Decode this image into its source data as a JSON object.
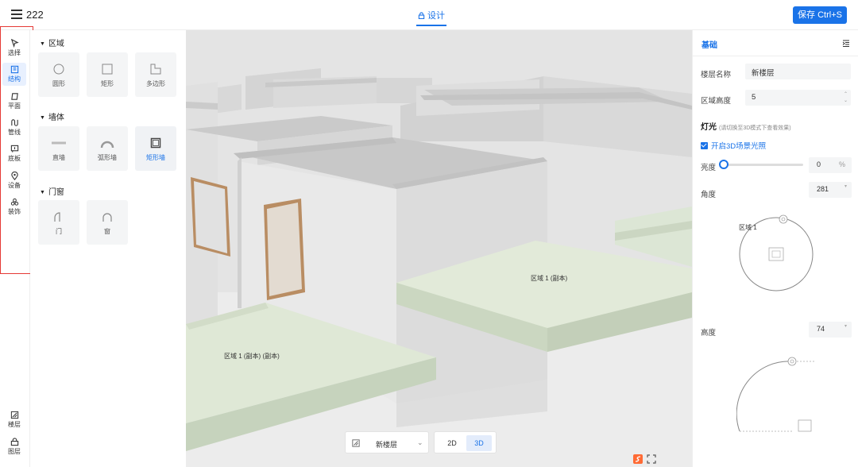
{
  "header": {
    "project_name": "222",
    "design_tab": "设计",
    "save_button": "保存 Ctrl+S"
  },
  "left_toolbar": {
    "tools": [
      {
        "label": "选择",
        "icon": "cursor-icon"
      },
      {
        "label": "结构",
        "icon": "structure-icon"
      },
      {
        "label": "平面",
        "icon": "plane-icon"
      },
      {
        "label": "管线",
        "icon": "pipeline-icon"
      },
      {
        "label": "底板",
        "icon": "baseboard-icon"
      },
      {
        "label": "设备",
        "icon": "location-pin-icon"
      },
      {
        "label": "装饰",
        "icon": "decoration-icon"
      }
    ],
    "bottom_tools": [
      {
        "label": "楼层",
        "icon": "floor-icon"
      },
      {
        "label": "图层",
        "icon": "layer-icon"
      }
    ]
  },
  "palette": {
    "sections": [
      {
        "title": "区域",
        "items": [
          "圆形",
          "矩形",
          "多边形"
        ]
      },
      {
        "title": "墙体",
        "items": [
          "直墙",
          "弧形墙",
          "矩形墙"
        ]
      },
      {
        "title": "门窗",
        "items": [
          "门",
          "窗"
        ]
      }
    ]
  },
  "viewport": {
    "labels": [
      "区域 1 (副本)",
      "区域 1 (副本) (副本)"
    ],
    "layer_select": "新楼层",
    "modes": [
      "2D",
      "3D"
    ],
    "active_mode": "3D"
  },
  "properties": {
    "tab": "基础",
    "floor_name_label": "楼层名称",
    "floor_name_value": "新楼层",
    "area_height_label": "区域高度",
    "area_height_value": "5",
    "light_title": "灯光",
    "light_hint": "(请切换至3D模式下查看效果)",
    "enable_light_label": "开启3D场景光照",
    "brightness_label": "亮度",
    "brightness_value": "0",
    "brightness_unit": "%",
    "angle_label": "角度",
    "angle_value": "281",
    "compass_label": "区域 1",
    "elevation_label": "高度",
    "elevation_value": "74"
  },
  "colors": {
    "accent": "#1a73e8",
    "highlight_frame": "#e53935",
    "floor_green": "#dfe8d6"
  }
}
